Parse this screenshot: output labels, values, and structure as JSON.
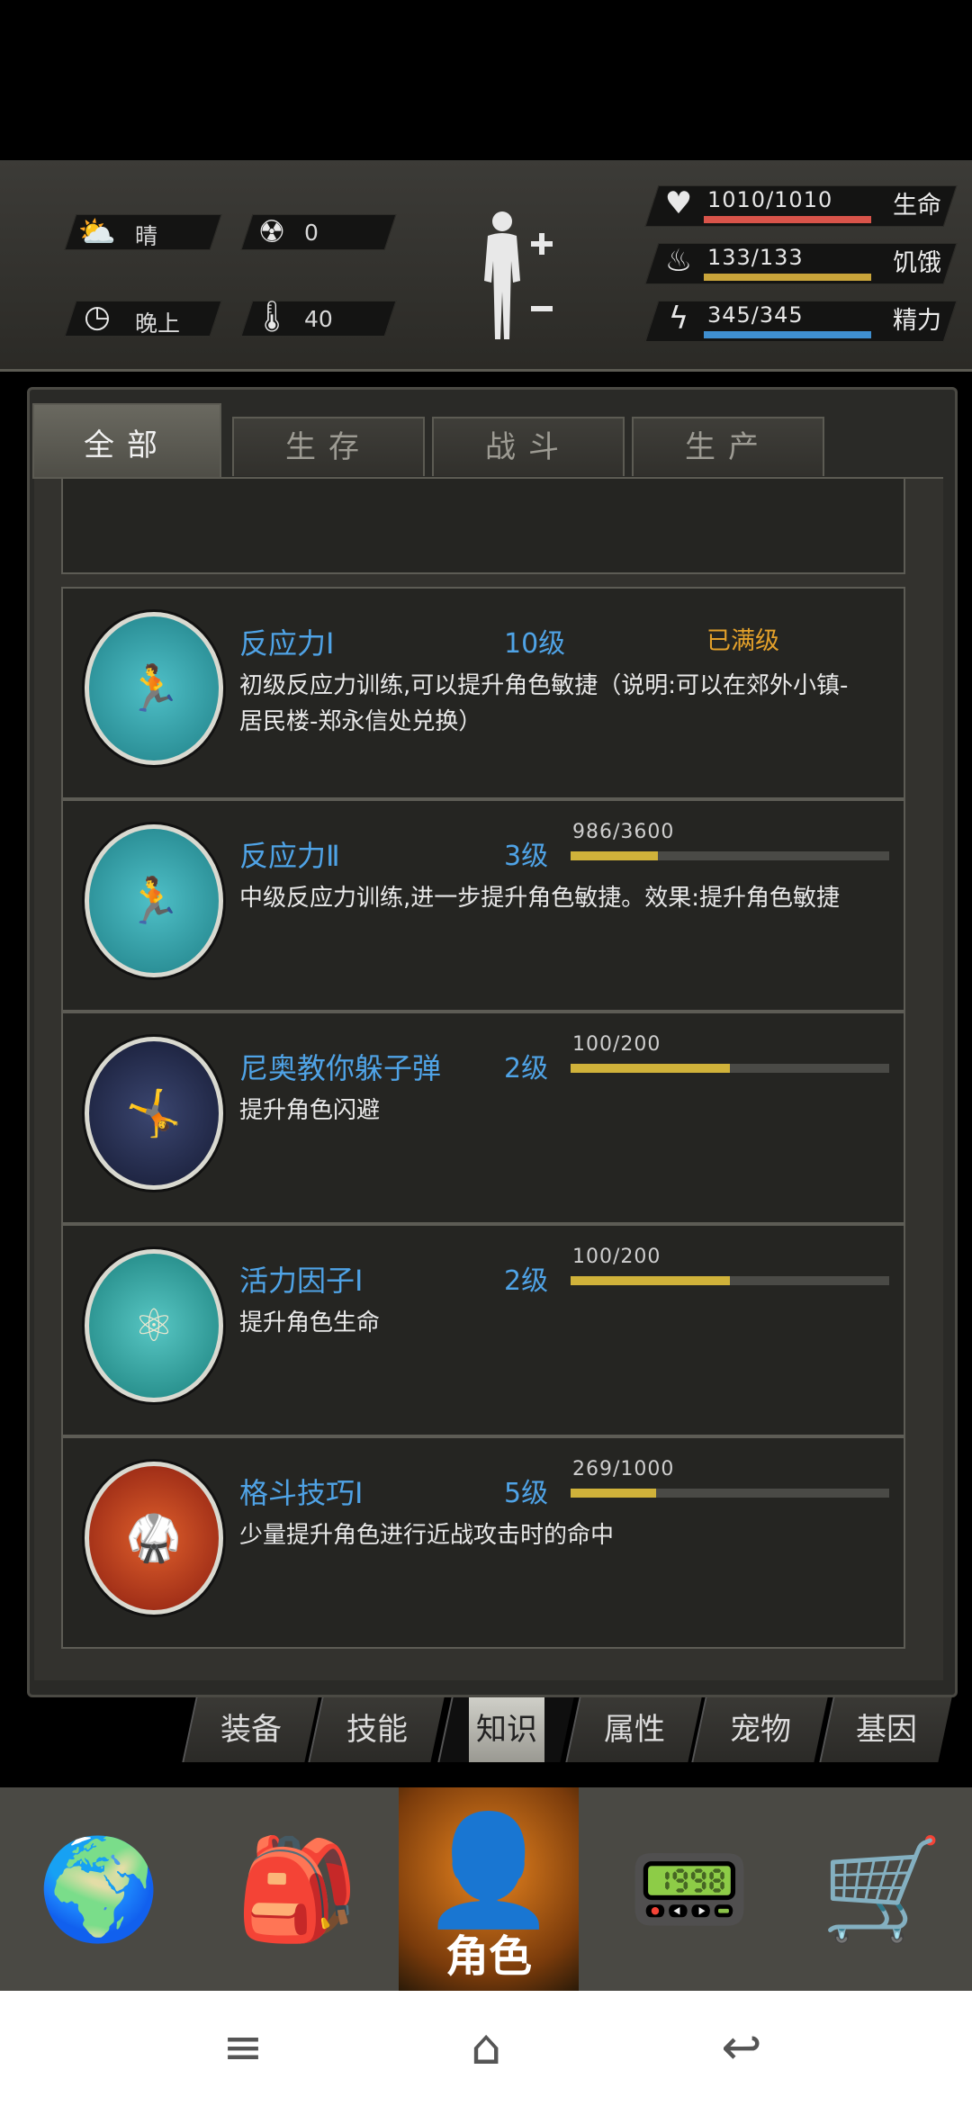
{
  "status": {
    "weather_label": "晴",
    "radiation_value": "0",
    "time_of_day": "晚上",
    "temperature_value": "40",
    "stats": [
      {
        "value": "1010/1010",
        "label": "生命",
        "color": "#d9544a",
        "fill": 1.0
      },
      {
        "value": "133/133",
        "label": "饥饿",
        "color": "#c9a43a",
        "fill": 1.0
      },
      {
        "value": "345/345",
        "label": "精力",
        "color": "#3f8fd0",
        "fill": 1.0
      }
    ]
  },
  "tabs": [
    "全部",
    "生存",
    "战斗",
    "生产"
  ],
  "skills": [
    {
      "name": "反应力Ⅰ",
      "level": "10级",
      "status": "已满级",
      "desc": "初级反应力训练,可以提升角色敏捷（说明:可以在郊外小镇-居民楼-郑永信处兑换）",
      "icon": "dodge-figure-icon",
      "badge": "I"
    },
    {
      "name": "反应力Ⅱ",
      "level": "3级",
      "progress": "986/3600",
      "fill": 0.274,
      "desc": "中级反应力训练,进一步提升角色敏捷。效果:提升角色敏捷",
      "icon": "dodge-figure-icon",
      "badge": "II"
    },
    {
      "name": "尼奥教你躲子弹",
      "level": "2级",
      "progress": "100/200",
      "fill": 0.5,
      "desc": "提升角色闪避",
      "icon": "matrix-dodge-icon",
      "badge": ""
    },
    {
      "name": "活力因子Ⅰ",
      "level": "2级",
      "progress": "100/200",
      "fill": 0.5,
      "desc": "提升角色生命",
      "icon": "molecule-icon",
      "badge": "I"
    },
    {
      "name": "格斗技巧Ⅰ",
      "level": "5级",
      "progress": "269/1000",
      "fill": 0.269,
      "desc": "少量提升角色进行近战攻击时的命中",
      "icon": "fighter-icon",
      "badge": "I"
    }
  ],
  "sub_tabs": [
    "装备",
    "技能",
    "知识",
    "属性",
    "宠物",
    "基因"
  ],
  "nav": {
    "active_label": "角色"
  }
}
